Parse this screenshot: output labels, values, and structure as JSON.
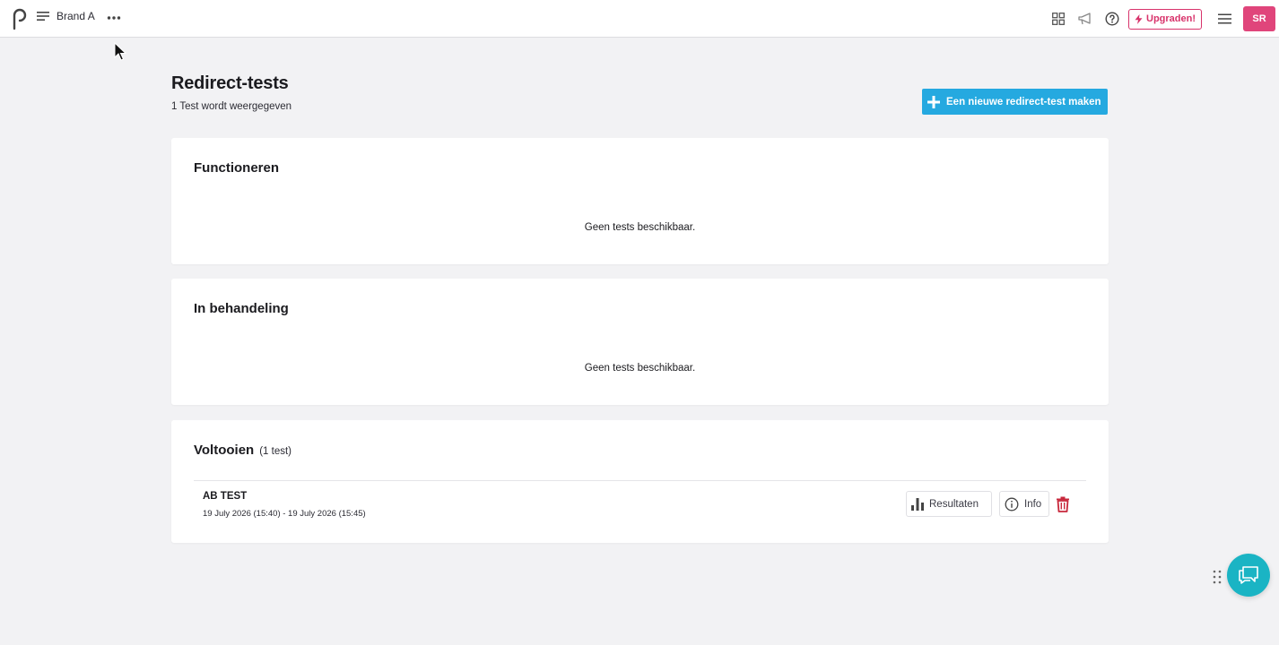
{
  "header": {
    "brand_name": "Brand A",
    "upgrade_label": "Upgraden!",
    "avatar_initials": "SR"
  },
  "page": {
    "title": "Redirect-tests",
    "subtitle": "1 Test wordt weergegeven",
    "new_button_label": "Een nieuwe redirect-test maken"
  },
  "sections": {
    "running": {
      "title": "Functioneren",
      "empty": "Geen tests beschikbaar."
    },
    "pending": {
      "title": "In behandeling",
      "empty": "Geen tests beschikbaar."
    },
    "completed": {
      "title": "Voltooien",
      "count": "(1 test)",
      "tests": [
        {
          "name": "AB TEST",
          "dates": "19 July 2026 (15:40) - 19 July 2026 (15:45)",
          "results_label": "Resultaten",
          "info_label": "Info"
        }
      ]
    }
  },
  "colors": {
    "accent_blue": "#25a9e0",
    "brand_pink": "#d8336b",
    "avatar_pink": "#e0457b",
    "chat_teal": "#1ab4c4",
    "delete_red": "#c8283c",
    "background": "#f2f2f4"
  },
  "icons": [
    "logo-icon",
    "menu-icon",
    "more-icon",
    "apps-grid-icon",
    "megaphone-icon",
    "help-icon",
    "lightning-icon",
    "hamburger-icon",
    "plus-icon",
    "bar-chart-icon",
    "info-icon",
    "trash-icon",
    "drag-handle-icon",
    "chat-icon"
  ]
}
